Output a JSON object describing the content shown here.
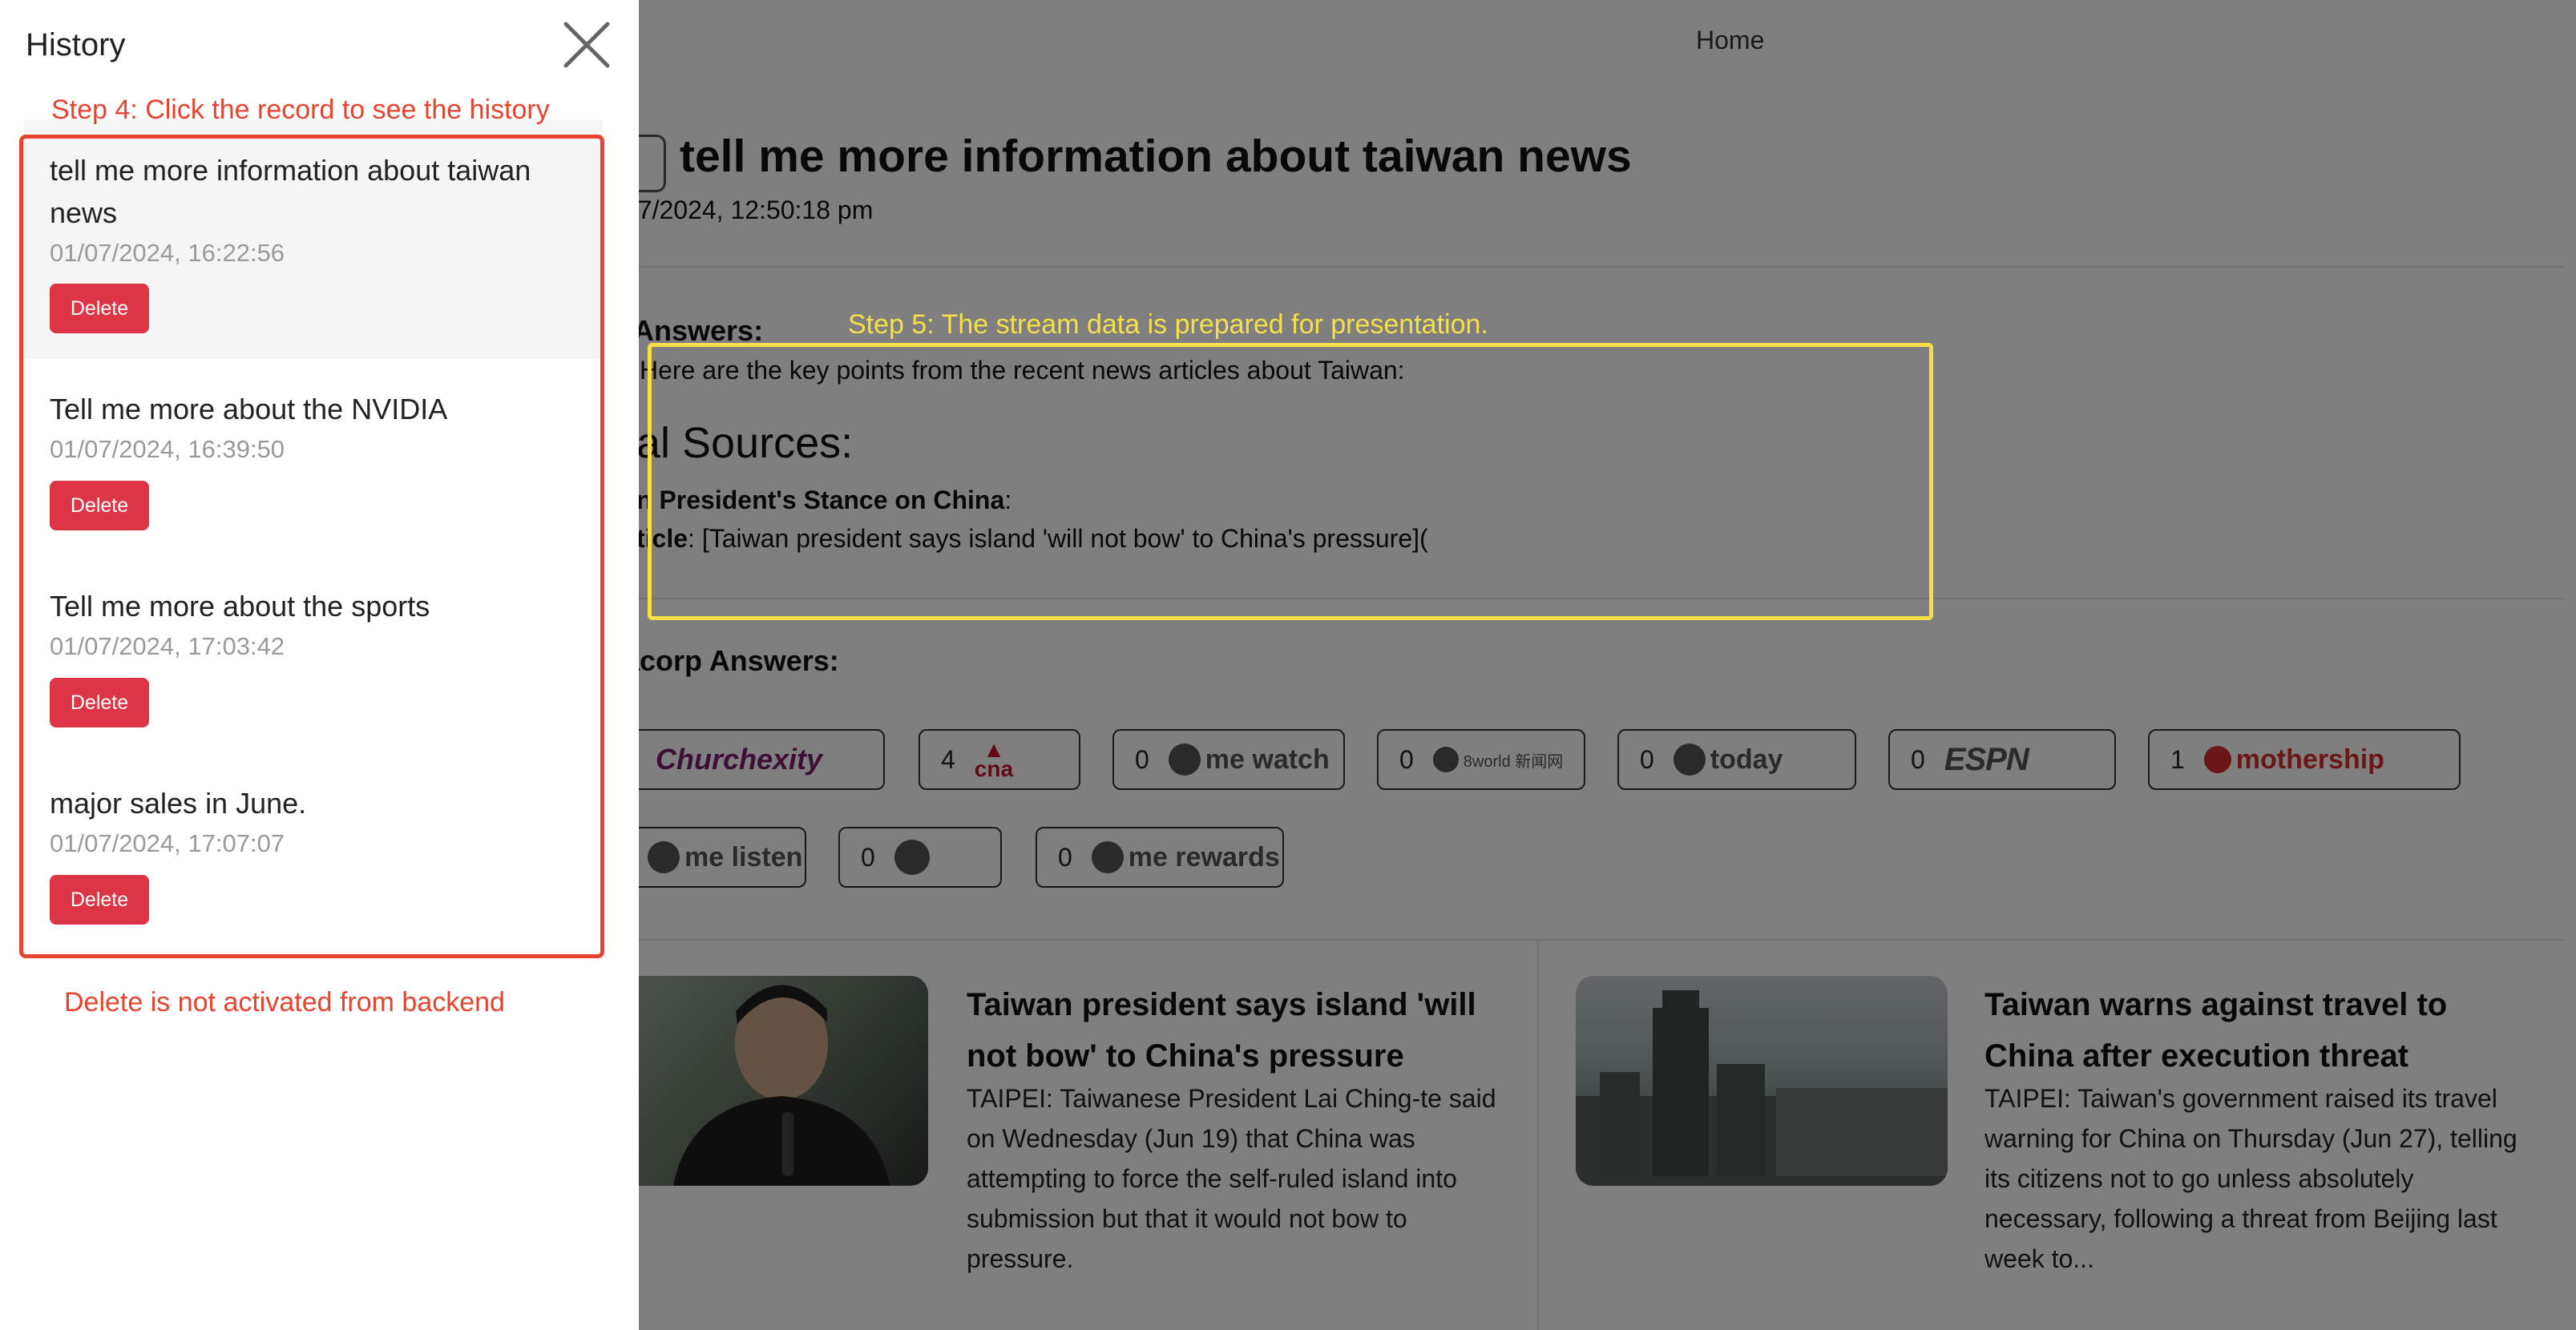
{
  "nav": {
    "home": "Home"
  },
  "question": {
    "title": "tell me more information about taiwan news",
    "timestamp": "07/2024, 12:50:18 pm"
  },
  "answers": {
    "label": "Answers:",
    "intro": "Here are the key points from the recent news articles about Taiwan:",
    "sources_heading": "al Sources:",
    "stance_bold": "n President's Stance on China",
    "stance_suffix": ":",
    "article_bold": "ticle",
    "article_text": ": [Taiwan president says island 'will not bow' to China's pressure]("
  },
  "mediacorp": {
    "label": "acorp Answers:",
    "sources": [
      {
        "brand": "Churchexity",
        "count": ""
      },
      {
        "brand": "cna",
        "count": "4"
      },
      {
        "brand": "me watch",
        "count": "0"
      },
      {
        "brand": "8world 新闻网",
        "count": "0"
      },
      {
        "brand": "today",
        "count": "0"
      },
      {
        "brand": "ESPN",
        "count": "0"
      },
      {
        "brand": "mothership",
        "count": "1"
      },
      {
        "brand": "me listen",
        "count": ""
      },
      {
        "brand": "",
        "count": "0"
      },
      {
        "brand": "me rewards",
        "count": "0"
      }
    ]
  },
  "articles": [
    {
      "title": "Taiwan president says island 'will not bow' to China's pressure",
      "summary": "TAIPEI: Taiwanese President Lai Ching-te said on Wednesday (Jun 19) that China was attempting to force the self-ruled island into submission but that it would not bow to pressure."
    },
    {
      "title": "Taiwan warns against travel to China after execution threat",
      "summary": "TAIPEI: Taiwan's government raised its travel warning for China on Thursday (Jun 27), telling its citizens not to go unless absolutely necessary, following a threat from Beijing last week to..."
    }
  ],
  "history": {
    "title": "History",
    "delete_label": "Delete",
    "records": [
      {
        "title": "tell me more information about taiwan news",
        "date": "01/07/2024, 16:22:56"
      },
      {
        "title": "Tell me more about the NVIDIA",
        "date": "01/07/2024, 16:39:50"
      },
      {
        "title": "Tell me more about the sports",
        "date": "01/07/2024, 17:03:42"
      },
      {
        "title": "major sales in June.",
        "date": "01/07/2024, 17:07:07"
      }
    ]
  },
  "annotations": {
    "step4": "Step 4: Click the record to see the history",
    "step5": "Step 5: The stream data is prepared for presentation.",
    "delete_note": "Delete is not activated from backend"
  },
  "colors": {
    "delete": "#dc3545",
    "annotation_red": "#e8432f",
    "annotation_yellow": "#f5e04a",
    "churchexity": "#7a1e6c",
    "mothership": "#d62f2f",
    "cna": "#c8102e"
  }
}
